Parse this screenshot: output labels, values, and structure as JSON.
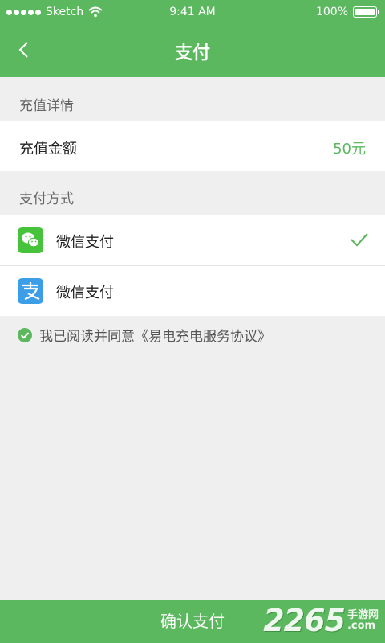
{
  "status_bar": {
    "carrier": "Sketch",
    "time": "9:41 AM",
    "battery": "100%"
  },
  "nav": {
    "title": "支付",
    "back_icon": "chevron-left-icon"
  },
  "recharge": {
    "section_label": "充值详情",
    "amount_label": "充值金额",
    "amount_value": "50元"
  },
  "payment": {
    "section_label": "支付方式",
    "methods": [
      {
        "name": "微信支付",
        "icon": "wechat-icon",
        "selected": true
      },
      {
        "name": "微信支付",
        "icon": "alipay-icon",
        "selected": false
      }
    ]
  },
  "agreement": {
    "text": "我已阅读并同意《易电充电服务协议》",
    "checked": true
  },
  "confirm_button": "确认支付",
  "watermark": {
    "number": "2265",
    "cn": "手游网",
    "com": ".com"
  },
  "colors": {
    "accent": "#5cb85f",
    "wechat": "#46c23b",
    "alipay": "#3d9ee8",
    "background": "#efefef"
  }
}
